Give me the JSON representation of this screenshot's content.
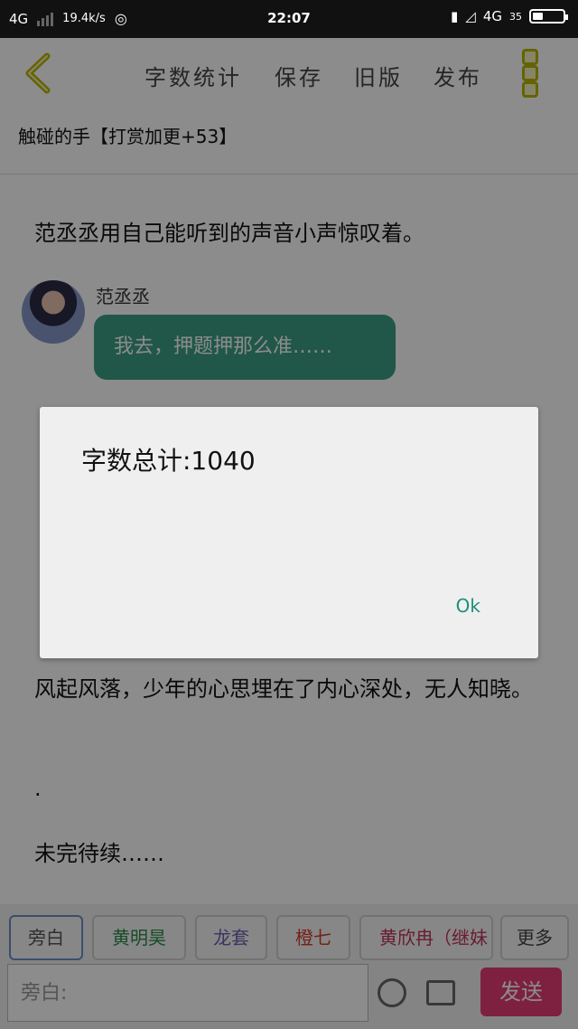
{
  "status_bar": {
    "network": "4G",
    "speed": "19.4k/s",
    "time": "22:07",
    "network_right": "4G",
    "battery_percent": "35",
    "battery_fill": 0.35
  },
  "toolbar": {
    "word_count": "字数统计",
    "save": "保存",
    "old_version": "旧版",
    "publish": "发布"
  },
  "chapter": {
    "title": "触碰的手【打赏加更+53】"
  },
  "content": {
    "paragraph_1": "范丞丞用自己能听到的声音小声惊叹着。",
    "speaker_name": "范丞丞",
    "bubble_text": "我去，押题押那么准……",
    "paragraph_2": "风起风落，少年的心思埋在了内心深处，无人知晓。",
    "paragraph_3": ".",
    "paragraph_4": "未完待续……"
  },
  "dialog": {
    "text": "字数总计:1040",
    "ok_label": "Ok"
  },
  "roles": [
    {
      "label": "旁白",
      "color": "#555555"
    },
    {
      "label": "黄明昊",
      "color": "#2c8a4a"
    },
    {
      "label": "龙套",
      "color": "#6a60b0"
    },
    {
      "label": "橙七",
      "color": "#d83a2a"
    },
    {
      "label": "黄欣冉（继妹",
      "color": "#c0325a"
    },
    {
      "label": "更多",
      "color": "#444444"
    }
  ],
  "input": {
    "placeholder": "旁白:"
  },
  "send": {
    "label": "发送"
  },
  "colors": {
    "accent_yellow": "#b8b400",
    "bubble_green": "#3b9e84",
    "send_pink": "#e63b74",
    "ok_teal": "#1f8f7a"
  }
}
